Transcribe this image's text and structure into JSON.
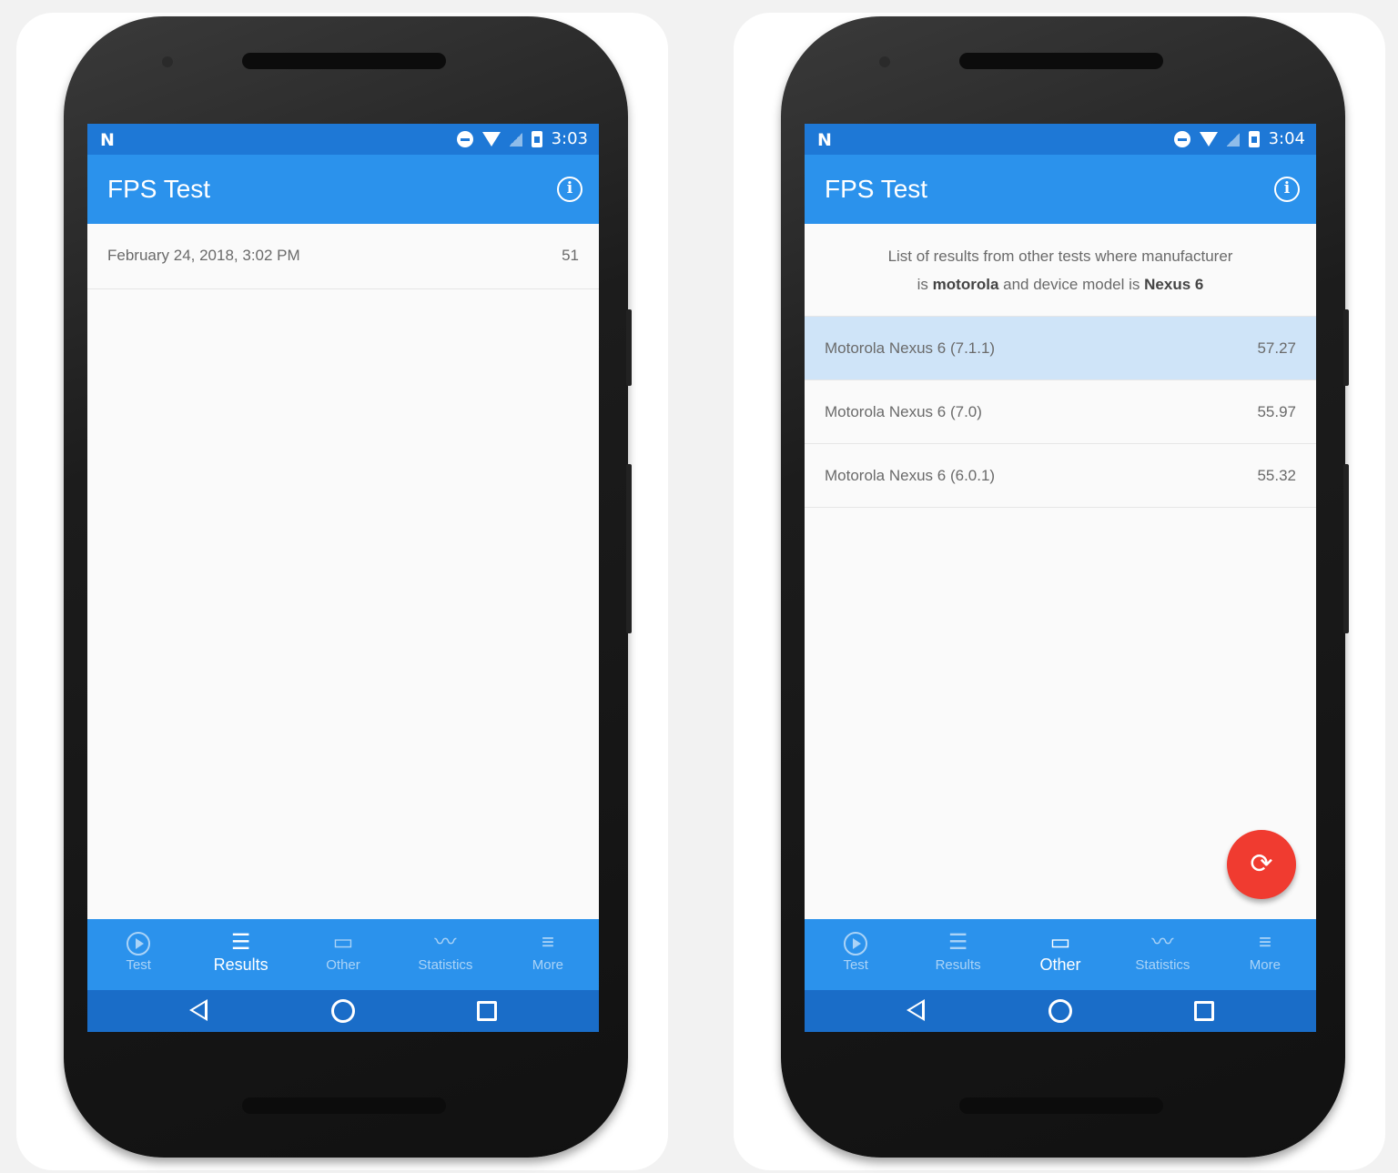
{
  "left": {
    "status": {
      "time": "3:03",
      "logo": "N"
    },
    "appbar": {
      "title": "FPS Test",
      "info_glyph": "i"
    },
    "results": [
      {
        "label": "February 24, 2018, 3:02 PM",
        "value": "51"
      }
    ],
    "nav": [
      {
        "label": "Test",
        "icon": "play-circle-icon"
      },
      {
        "label": "Results",
        "icon": "list-icon"
      },
      {
        "label": "Other",
        "icon": "devices-icon"
      },
      {
        "label": "Statistics",
        "icon": "trending-icon"
      },
      {
        "label": "More",
        "icon": "menu-icon"
      }
    ],
    "active_tab": "Results"
  },
  "right": {
    "status": {
      "time": "3:04",
      "logo": "N"
    },
    "appbar": {
      "title": "FPS Test",
      "info_glyph": "i"
    },
    "header": {
      "line1": "List of results from other tests where manufacturer",
      "is": "is",
      "manufacturer": "motorola",
      "mid": "and device model is",
      "model": "Nexus 6"
    },
    "results": [
      {
        "label": "Motorola Nexus 6 (7.1.1)",
        "value": "57.27"
      },
      {
        "label": "Motorola Nexus 6 (7.0)",
        "value": "55.97"
      },
      {
        "label": "Motorola Nexus 6 (6.0.1)",
        "value": "55.32"
      }
    ],
    "nav": [
      {
        "label": "Test",
        "icon": "play-circle-icon"
      },
      {
        "label": "Results",
        "icon": "list-icon"
      },
      {
        "label": "Other",
        "icon": "devices-icon"
      },
      {
        "label": "Statistics",
        "icon": "trending-icon"
      },
      {
        "label": "More",
        "icon": "menu-icon"
      }
    ],
    "active_tab": "Other",
    "fab": {
      "icon": "refresh-icon",
      "glyph": "⟳"
    }
  },
  "colors": {
    "status_bar": "#1e78d6",
    "app_bar": "#2b92ec",
    "system_nav": "#1a6dc8",
    "selected_row": "#cfe4f8",
    "fab": "#f03b30"
  },
  "glyphs": {
    "list": "☰",
    "devices": "▭",
    "trending": "〰",
    "menu": "≡"
  }
}
